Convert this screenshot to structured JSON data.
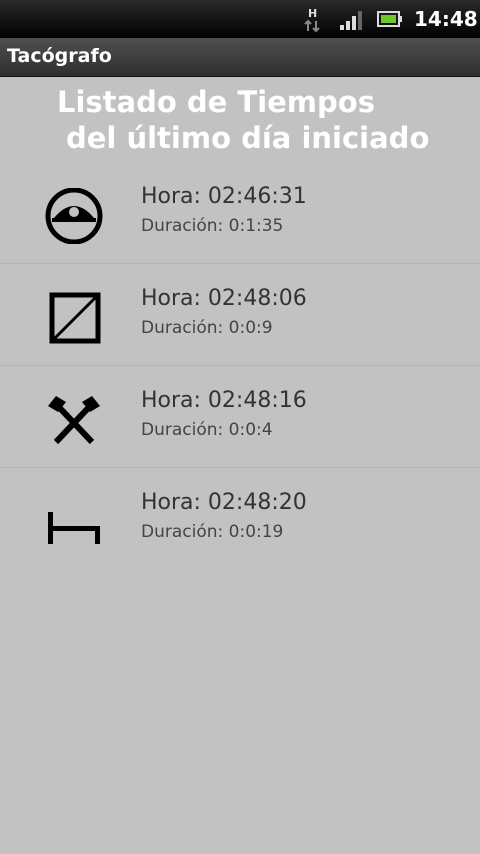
{
  "status_bar": {
    "network_type": "H",
    "time": "14:48",
    "icons": [
      "network-h-icon",
      "signal-icon",
      "battery-icon"
    ]
  },
  "app_bar": {
    "title": "Tacógrafo"
  },
  "heading": {
    "line1": "Listado de Tiempos",
    "line2": "del último día iniciado"
  },
  "entries": [
    {
      "icon": "driving-icon",
      "hora": "Hora: 02:46:31",
      "duracion": "Duración: 0:1:35"
    },
    {
      "icon": "availability-icon",
      "hora": "Hora: 02:48:06",
      "duracion": "Duración: 0:0:9"
    },
    {
      "icon": "work-hammers-icon",
      "hora": "Hora: 02:48:16",
      "duracion": "Duración: 0:0:4"
    },
    {
      "icon": "rest-bed-icon",
      "hora": "Hora: 02:48:20",
      "duracion": "Duración: 0:0:19"
    }
  ],
  "colors": {
    "background": "#c2c2c2",
    "heading_text": "#ffffff",
    "row_text": "#333333",
    "icon": "#000000"
  }
}
